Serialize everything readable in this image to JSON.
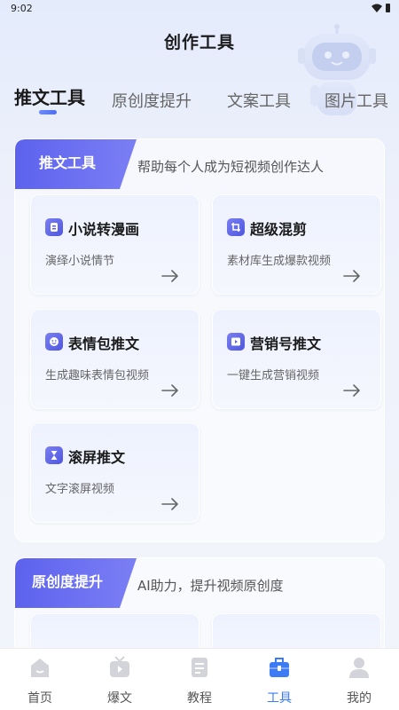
{
  "status_bar": {
    "time": "9:02"
  },
  "page_title": "创作工具",
  "tabs": [
    {
      "label": "推文工具",
      "active": true
    },
    {
      "label": "原创度提升",
      "active": false
    },
    {
      "label": "文案工具",
      "active": false
    },
    {
      "label": "图片工具",
      "active": false
    }
  ],
  "sections": [
    {
      "title": "推文工具",
      "subtitle": "帮助每个人成为短视频创作达人",
      "cards": [
        {
          "title": "小说转漫画",
          "desc": "演绎小说情节",
          "icon": "book-icon"
        },
        {
          "title": "超级混剪",
          "desc": "素材库生成爆款视频",
          "icon": "crop-icon"
        },
        {
          "title": "表情包推文",
          "desc": "生成趣味表情包视频",
          "icon": "smiley-icon"
        },
        {
          "title": "营销号推文",
          "desc": "一键生成营销视频",
          "icon": "video-play-icon"
        },
        {
          "title": "滚屏推文",
          "desc": "文字滚屏视频",
          "icon": "hourglass-icon"
        }
      ]
    },
    {
      "title": "原创度提升",
      "subtitle": "AI助力，提升视频原创度"
    }
  ],
  "bottom_nav": [
    {
      "label": "首页",
      "icon": "home-icon",
      "active": false
    },
    {
      "label": "爆文",
      "icon": "tv-icon",
      "active": false
    },
    {
      "label": "教程",
      "icon": "document-icon",
      "active": false
    },
    {
      "label": "工具",
      "icon": "toolbox-icon",
      "active": true
    },
    {
      "label": "我的",
      "icon": "user-icon",
      "active": false
    }
  ],
  "colors": {
    "accent": "#4f6ef7",
    "nav_active": "#3d7bf5",
    "badge_start": "#6f74f2",
    "badge_end": "#4d56e6"
  }
}
